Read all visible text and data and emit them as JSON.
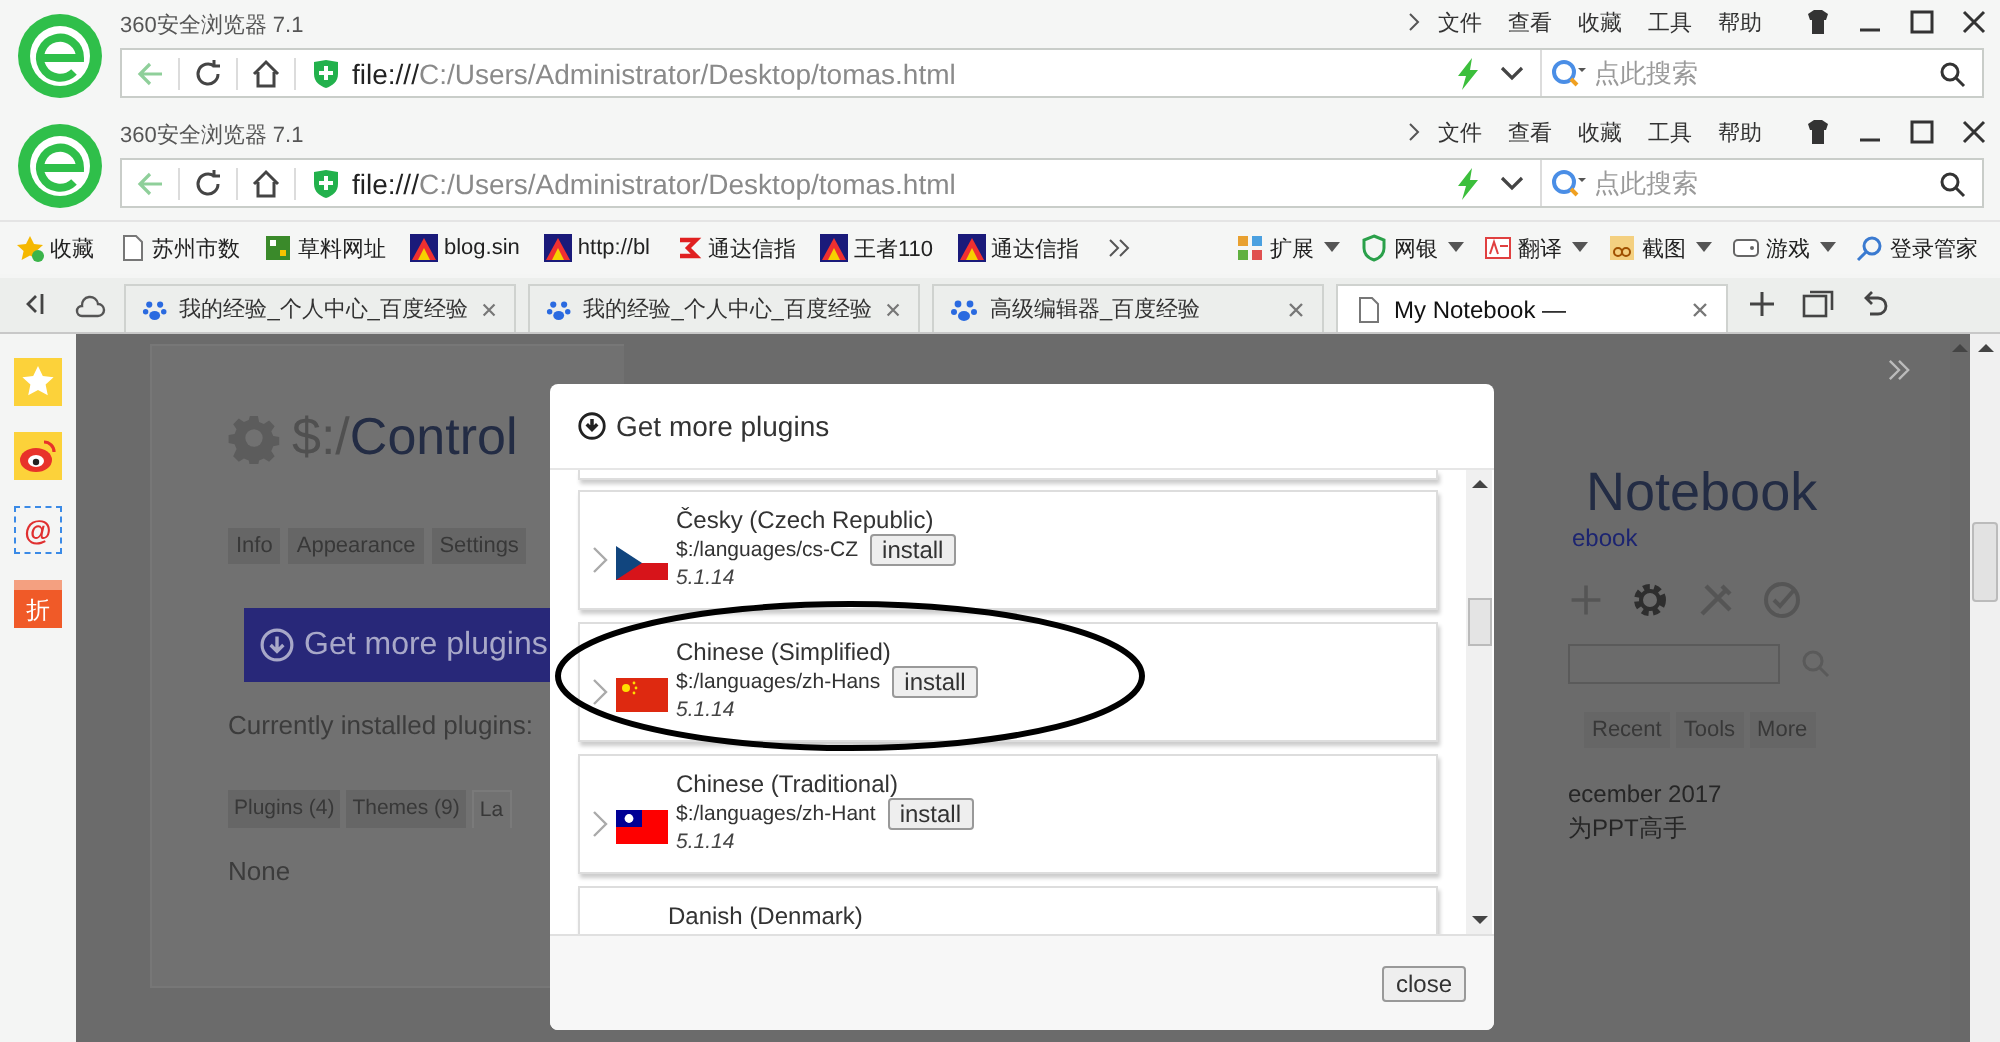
{
  "browser_frames": [
    {
      "title": "360安全浏览器 7.1",
      "menu": [
        "文件",
        "查看",
        "收藏",
        "工具",
        "帮助"
      ],
      "address": {
        "scheme": "file:///",
        "path": "C:/Users/Administrator/Desktop/tomas.html"
      },
      "search": {
        "placeholder": "点此搜索"
      }
    },
    {
      "title": "360安全浏览器 7.1",
      "menu": [
        "文件",
        "查看",
        "收藏",
        "工具",
        "帮助"
      ],
      "address": {
        "scheme": "file:///",
        "path": "C:/Users/Administrator/Desktop/tomas.html"
      },
      "search": {
        "placeholder": "点此搜索"
      }
    }
  ],
  "bookmarks": [
    {
      "label": "收藏",
      "kind": "favorites"
    },
    {
      "label": "苏州市数",
      "kind": "page"
    },
    {
      "label": "草料网址",
      "kind": "qr"
    },
    {
      "label": "blog.sin",
      "kind": "site"
    },
    {
      "label": "http://bl",
      "kind": "site"
    },
    {
      "label": "通达信指",
      "kind": "logo"
    },
    {
      "label": "王者110",
      "kind": "site"
    },
    {
      "label": "通达信指",
      "kind": "site"
    }
  ],
  "extensions": [
    {
      "label": "扩展",
      "kind": "grid"
    },
    {
      "label": "网银",
      "kind": "shield"
    },
    {
      "label": "翻译",
      "kind": "translate"
    },
    {
      "label": "截图",
      "kind": "scissors"
    },
    {
      "label": "游戏",
      "kind": "game"
    },
    {
      "label": "登录管家",
      "kind": "key"
    }
  ],
  "tabs": [
    {
      "label": "我的经验_个人中心_百度经验",
      "selected": false
    },
    {
      "label": "我的经验_个人中心_百度经验",
      "selected": false
    },
    {
      "label": "高级编辑器_百度经验",
      "selected": false
    },
    {
      "label": "My Notebook —",
      "selected": true
    }
  ],
  "sidebar_icons": [
    {
      "kind": "star"
    },
    {
      "kind": "weibo"
    },
    {
      "kind": "mail",
      "label": "@"
    },
    {
      "kind": "discount",
      "label": "折"
    }
  ],
  "page": {
    "title_prefix": "$:/",
    "title": "Control",
    "tabs": [
      {
        "label": "Info",
        "selected": false
      },
      {
        "label": "Appearance",
        "selected": false
      },
      {
        "label": "Settings",
        "selected": false
      }
    ],
    "get_plugins_button": "Get more plugins",
    "installed_label": "Currently installed plugins:",
    "plugin_tabs": [
      {
        "label": "Plugins (4)",
        "selected": false
      },
      {
        "label": "Themes (9)",
        "selected": false
      },
      {
        "label": "La",
        "selected": true
      }
    ],
    "installed_value": "None"
  },
  "sidebar_panel": {
    "title": "Notebook",
    "subtitle": "ebook",
    "tabs": [
      {
        "label": "Recent",
        "selected": false
      },
      {
        "label": "Tools",
        "selected": false
      },
      {
        "label": "More",
        "selected": false
      }
    ],
    "date": "ecember 2017",
    "entry": "为PPT高手"
  },
  "modal": {
    "title": "Get more plugins",
    "plugins": [
      {
        "name": "Česky (Czech Republic)",
        "path": "$:/languages/cs-CZ",
        "version": "5.1.14",
        "kind": "cz",
        "install": "install",
        "circled": false
      },
      {
        "name": "Chinese (Simplified)",
        "path": "$:/languages/zh-Hans",
        "version": "5.1.14",
        "kind": "cn",
        "install": "install",
        "circled": true
      },
      {
        "name": "Chinese (Traditional)",
        "path": "$:/languages/zh-Hant",
        "version": "5.1.14",
        "kind": "tw",
        "install": "install",
        "circled": false
      },
      {
        "name": "Danish (Denmark)",
        "circled": false
      }
    ],
    "close": "close"
  }
}
